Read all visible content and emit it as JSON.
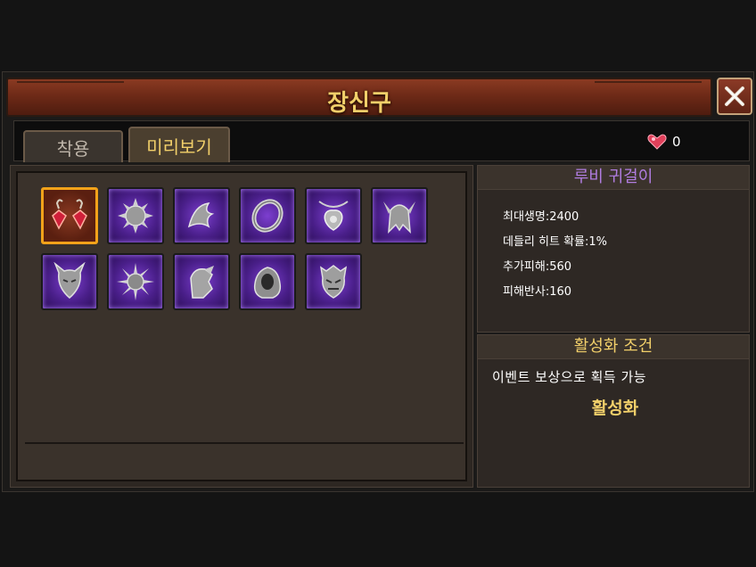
{
  "window": {
    "title": "장신구"
  },
  "tabs": [
    {
      "label": "착용",
      "active": false
    },
    {
      "label": "미리보기",
      "active": true
    }
  ],
  "currency": {
    "icon": "heart-gem-icon",
    "value": "0",
    "color": "#e0405a"
  },
  "items": [
    {
      "icon": "ruby-earring-icon",
      "selected": true
    },
    {
      "icon": "spiked-orb-icon",
      "selected": false
    },
    {
      "icon": "dragon-claw-icon",
      "selected": false
    },
    {
      "icon": "ring-icon",
      "selected": false
    },
    {
      "icon": "pendant-icon",
      "selected": false
    },
    {
      "icon": "winged-helm-icon",
      "selected": false
    },
    {
      "icon": "horned-mask-icon",
      "selected": false
    },
    {
      "icon": "spiked-ball-icon",
      "selected": false
    },
    {
      "icon": "gauntlet-icon",
      "selected": false
    },
    {
      "icon": "hooded-cloak-icon",
      "selected": false
    },
    {
      "icon": "demon-mask-icon",
      "selected": false
    }
  ],
  "detail": {
    "name": "루비 귀걸이",
    "stats": [
      "최대생명:2400",
      "데들리 히트 확률:1%",
      "추가피해:560",
      "피해반사:160"
    ]
  },
  "condition": {
    "title": "활성화 조건",
    "text": "이벤트 보상으로 획득 가능",
    "button": "활성화"
  },
  "colors": {
    "accent_gold": "#f1cf6a",
    "rarity_purple": "#7d3fd0",
    "selected_border": "#f2a21a"
  }
}
